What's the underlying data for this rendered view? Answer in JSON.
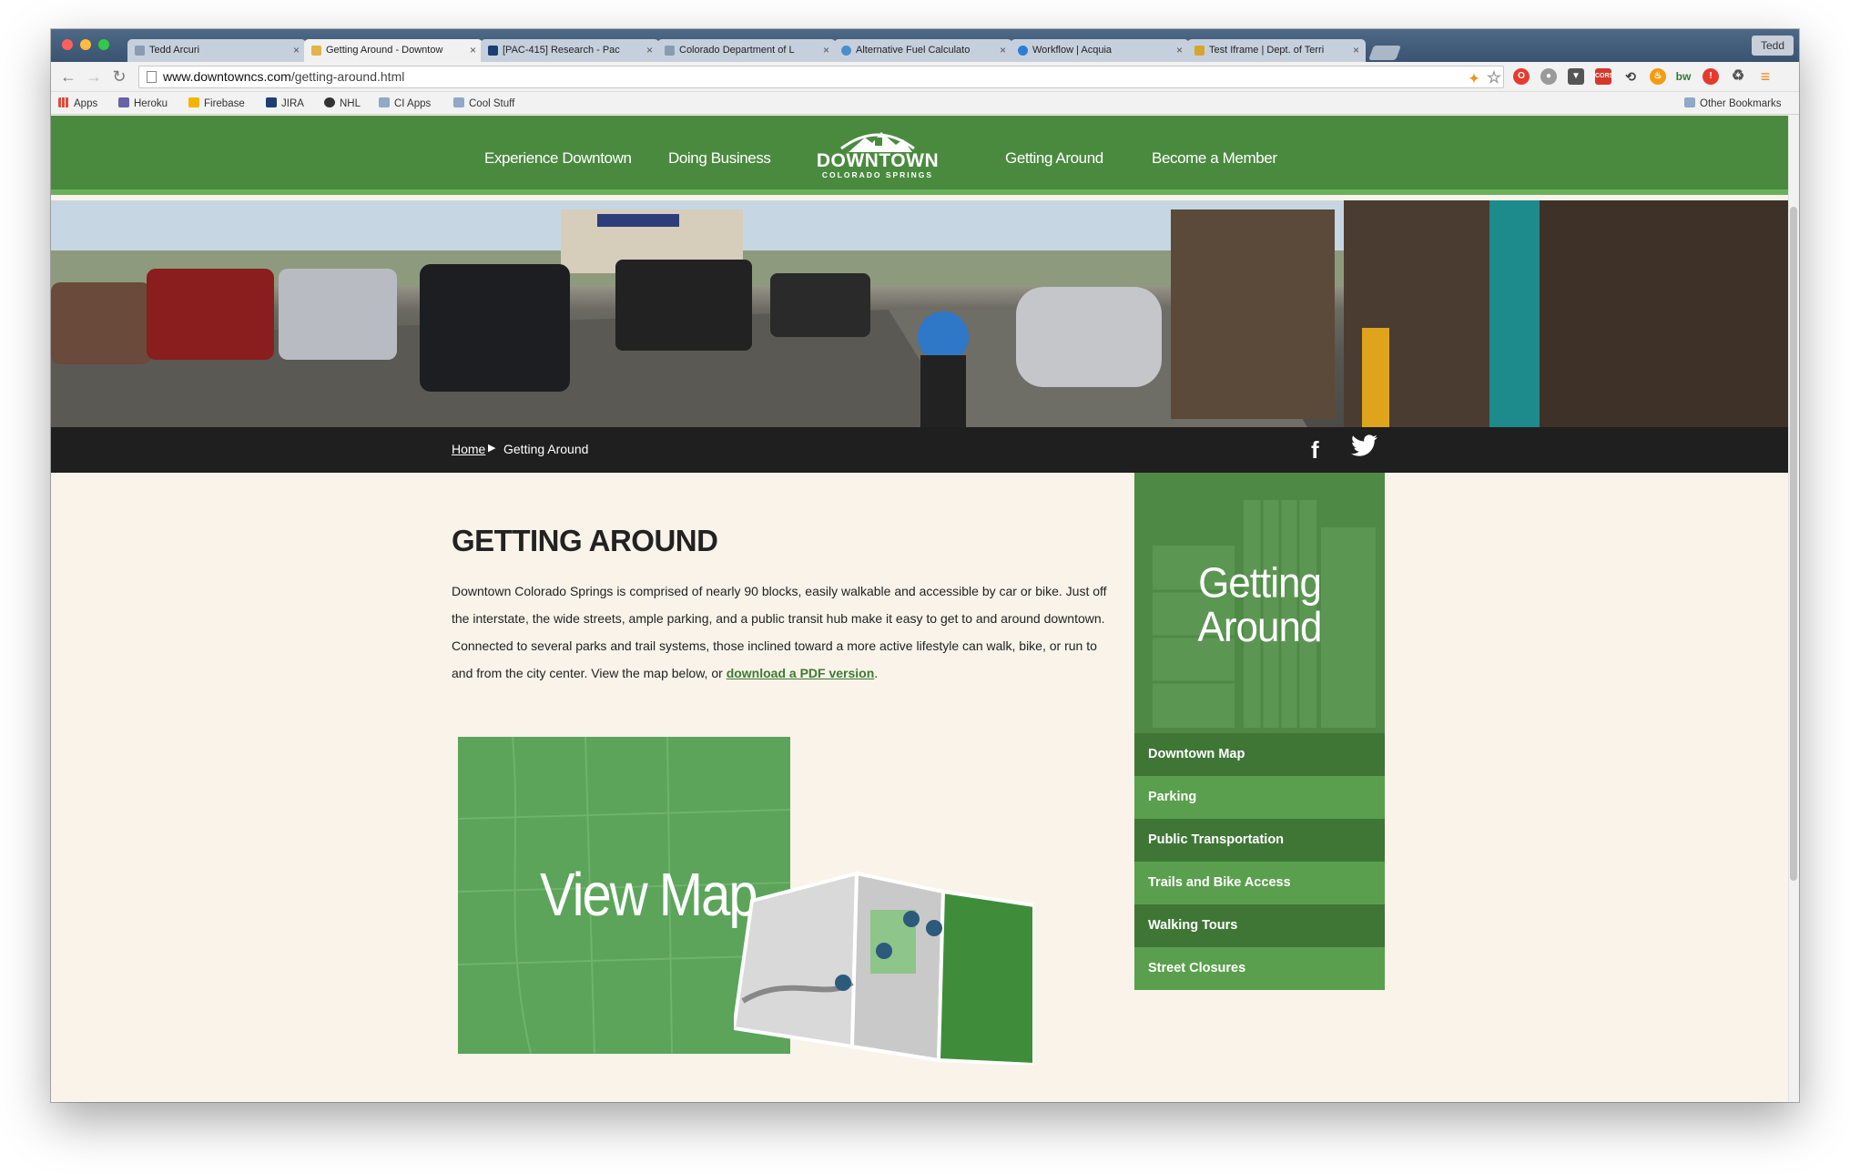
{
  "browser": {
    "tabs": [
      {
        "title": "Tedd Arcuri",
        "active": false
      },
      {
        "title": "Getting Around - Downtow",
        "active": true
      },
      {
        "title": "[PAC-415] Research - Pac",
        "active": false
      },
      {
        "title": "Colorado Department of L",
        "active": false
      },
      {
        "title": "Alternative Fuel Calculato",
        "active": false
      },
      {
        "title": "Workflow | Acquia",
        "active": false
      },
      {
        "title": "Test Iframe | Dept. of Terri",
        "active": false
      }
    ],
    "profile_name": "Tedd",
    "url_host": "www.downtowncs.com",
    "url_path": "/getting-around.html",
    "bookmarks": [
      "Apps",
      "Heroku",
      "Firebase",
      "JIRA",
      "NHL",
      "CI Apps",
      "Cool Stuff"
    ],
    "other_bookmarks": "Other Bookmarks"
  },
  "site": {
    "nav": {
      "experience": "Experience Downtown",
      "business": "Doing Business",
      "getting_around": "Getting Around",
      "member": "Become a Member"
    },
    "logo": {
      "line1": "DOWNTOWN",
      "line2": "COLORADO SPRINGS"
    },
    "breadcrumb": {
      "home": "Home",
      "current": "Getting Around"
    },
    "social": {
      "facebook": "f"
    }
  },
  "main": {
    "heading": "GETTING AROUND",
    "body_text": "Downtown Colorado Springs is comprised of nearly 90 blocks, easily walkable and accessible by car or bike.  Just off the interstate, the wide streets, ample parking, and a public transit hub make it easy to get to and around downtown. Connected to several parks and trail systems, those inclined toward a more active lifestyle can walk, bike, or run to and from the city center. View the map below, or ",
    "pdf_link": "download a PDF version",
    "body_end": ".",
    "map_card_label": "View Map"
  },
  "sidebar": {
    "title_line1": "Getting",
    "title_line2": "Around",
    "items": [
      "Downtown Map",
      "Parking",
      "Public Transportation",
      "Trails and Bike Access",
      "Walking Tours",
      "Street Closures"
    ]
  },
  "colors": {
    "nav_green": "#4a8a3f",
    "accent_green": "#6ab05c",
    "sidebar_dark": "#3f7636",
    "sidebar_light": "#5a9f4d",
    "link_green": "#3d7a34"
  }
}
